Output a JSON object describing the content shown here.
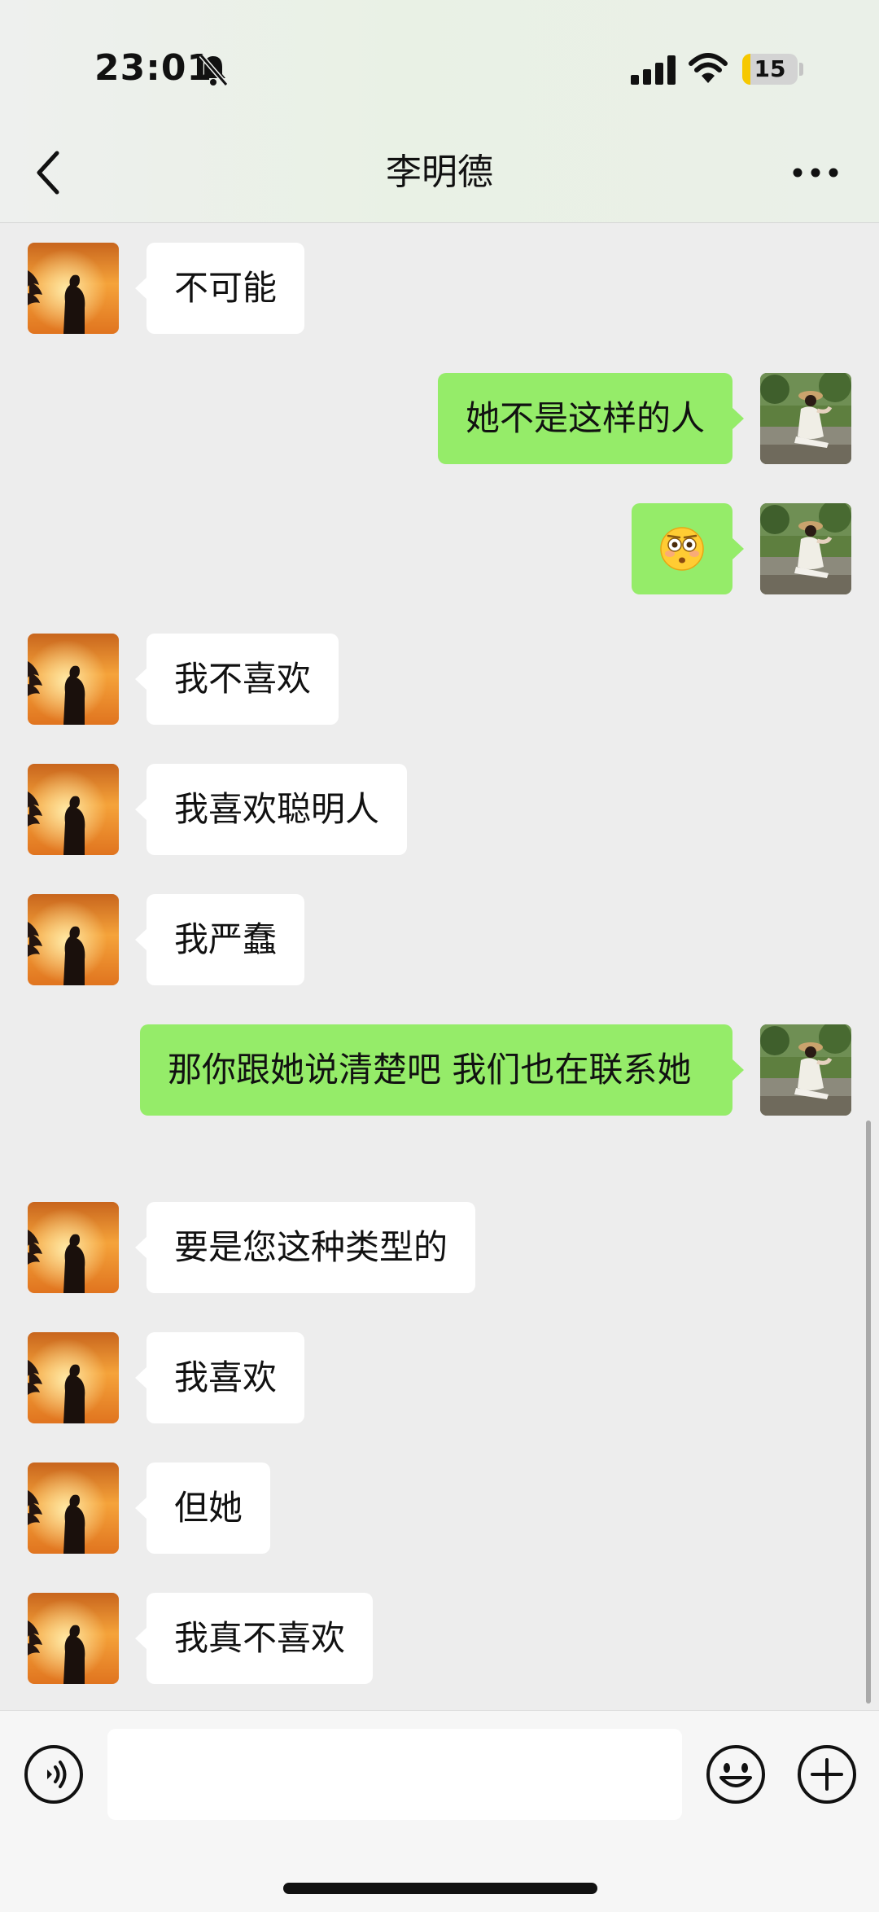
{
  "status_bar": {
    "time": "23:01",
    "battery_level": "15",
    "icons": [
      "bell-slash-icon",
      "signal-icon",
      "wifi-icon",
      "battery-icon"
    ]
  },
  "header": {
    "title": "李明德",
    "back_icon": "chevron-left-icon",
    "more_icon": "more-dots-icon"
  },
  "messages": [
    {
      "from": "contact",
      "text": "不可能"
    },
    {
      "from": "me",
      "text": "她不是这样的人"
    },
    {
      "from": "me",
      "emoji": "flushed-face-emoji"
    },
    {
      "from": "contact",
      "text": "我不喜欢"
    },
    {
      "from": "contact",
      "text": "我喜欢聪明人"
    },
    {
      "from": "contact",
      "text": "我严蠢"
    },
    {
      "from": "me",
      "text": "那你跟她说清楚吧 我们也在联系她"
    },
    {
      "from": "contact",
      "text": "要是您这种类型的"
    },
    {
      "from": "contact",
      "text": "我喜欢"
    },
    {
      "from": "contact",
      "text": "但她"
    },
    {
      "from": "contact",
      "text": "我真不喜欢"
    }
  ],
  "input_bar": {
    "value": "",
    "icons": [
      "voice-icon",
      "emoji-icon",
      "plus-icon"
    ]
  },
  "colors": {
    "chat_background": "#ededed",
    "outgoing_bubble": "#95ec69",
    "incoming_bubble": "#ffffff",
    "battery_accent": "#f6c800"
  }
}
